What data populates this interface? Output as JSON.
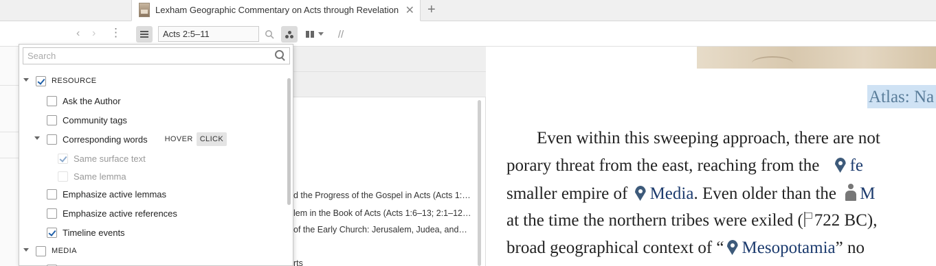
{
  "tab": {
    "title": "Lexham Geographic Commentary on Acts through Revelation",
    "close_glyph": "✕",
    "new_tab_glyph": "+"
  },
  "left_pane": {
    "back_glyph": "‹",
    "forward_glyph": "›",
    "more_glyph": "⋮"
  },
  "toolbar": {
    "reference_value": "Acts 2:5–11",
    "parallel_glyph": "//"
  },
  "dropdown": {
    "search_placeholder": "Search",
    "resource": {
      "label": "RESOURCE",
      "checked": true,
      "items": [
        {
          "label": "Ask the Author",
          "checked": false
        },
        {
          "label": "Community tags",
          "checked": false
        },
        {
          "label": "Corresponding words",
          "checked": false,
          "hover_label": "HOVER",
          "click_label": "CLICK",
          "mode": "CLICK"
        },
        {
          "label": "Same surface text",
          "checked": true,
          "disabled": true
        },
        {
          "label": "Same lemma",
          "checked": false,
          "disabled": true
        },
        {
          "label": "Emphasize active lemmas",
          "checked": false
        },
        {
          "label": "Emphasize active references",
          "checked": false
        },
        {
          "label": "Timeline events",
          "checked": true
        }
      ]
    },
    "media": {
      "label": "MEDIA",
      "checked": false
    }
  },
  "middle_pane": {
    "lines": [
      "d the Progress of the Gospel in Acts (Acts 1:…",
      "lem in the Book of Acts (Acts 1:6–13; 2:1–12…",
      "of the Early Church: Jerusalem, Judea, and…",
      "rts"
    ]
  },
  "reading_pane": {
    "atlas_label": "Atlas: Na",
    "lines": {
      "l1": "Even within this sweeping approach, there are not",
      "l2_a": "porary threat from the east, reaching from the",
      "l2_link": "fe",
      "l3_a": "smaller empire of",
      "l3_link": "Media",
      "l3_b": ". Even older than the",
      "l3_link2": "M",
      "l4_a": "at the time the northern tribes were exiled (",
      "l4_year": "722 BC",
      "l4_b": "),",
      "l5_a": "broad geographical context of “",
      "l5_link": "Mesopotamia",
      "l5_b": "” no"
    }
  },
  "colors": {
    "link": "#1c3b6e",
    "checkbox_check": "#1f5fa8",
    "atlas_highlight": "#cfe2f4"
  }
}
